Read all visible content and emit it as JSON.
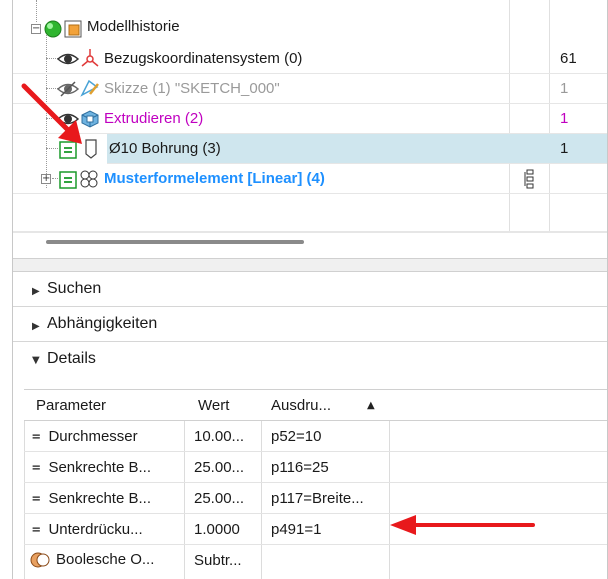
{
  "tree": {
    "rows": [
      {
        "label": "Modellhistorie",
        "col2": "",
        "num": ""
      },
      {
        "label": "Bezugskoordinatensystem (0)",
        "col2": "",
        "num": "61"
      },
      {
        "label": "Skizze (1) \"SKETCH_000\"",
        "col2": "",
        "num": "1"
      },
      {
        "label": "Extrudieren (2)",
        "col2": "",
        "num": "1"
      },
      {
        "label": "Ø10 Bohrung (3)",
        "col2": "",
        "num": "1"
      },
      {
        "label": "Musterformelement [Linear] (4)",
        "col2": "",
        "num": ""
      }
    ],
    "icons": [
      "status-green-icon",
      "model-history-icon",
      "eye-icon",
      "coordinate-system-icon",
      "eye-hidden-icon",
      "sketch-icon",
      "extrude-icon",
      "checkbox-equals-icon",
      "hole-icon",
      "pattern-icon",
      "hierarchy-icon"
    ]
  },
  "sections": {
    "search": "Suchen",
    "dependencies": "Abhängigkeiten",
    "details": "Details"
  },
  "details": {
    "headers": [
      "Parameter",
      "Wert",
      "Ausdru..."
    ],
    "rows": [
      {
        "param": "Durchmesser",
        "value": "10.00...",
        "expr": "p52=10",
        "icon": "equals-icon"
      },
      {
        "param": "Senkrechte B...",
        "value": "25.00...",
        "expr": "p116=25",
        "icon": "equals-icon"
      },
      {
        "param": "Senkrechte B...",
        "value": "25.00...",
        "expr": "p117=Breite...",
        "icon": "equals-icon"
      },
      {
        "param": "Unterdrücku...",
        "value": "1.0000",
        "expr": "p491=1",
        "icon": "equals-icon"
      },
      {
        "param": "Boolesche O...",
        "value": "Subtr...",
        "expr": "",
        "icon": "boolean-icon"
      }
    ]
  },
  "colors": {
    "selection": "#cfe6ee",
    "extrude_text": "#c000c0",
    "pattern_text": "#1e90ff",
    "sketch_text": "#9a9a9a",
    "annotation_arrow": "#e8191c"
  }
}
